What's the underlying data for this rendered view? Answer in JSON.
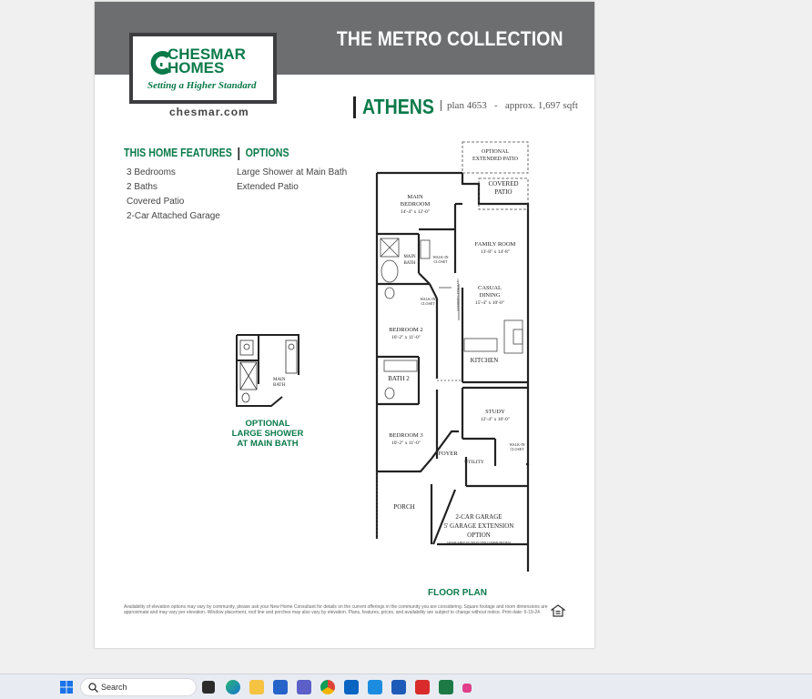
{
  "header": {
    "collection_title": "THE METRO COLLECTION"
  },
  "logo": {
    "line1": "CHESMAR",
    "line2": "HOMES",
    "tagline": "Setting a Higher Standard"
  },
  "website": "chesmar.com",
  "plan": {
    "name": "ATHENS",
    "plan_number": "plan 4653",
    "separator": "-",
    "size": "approx. 1,697 sqft"
  },
  "features": {
    "heading": "THIS HOME FEATURES",
    "options_heading": "OPTIONS",
    "items": [
      "3 Bedrooms",
      "2 Baths",
      "Covered Patio",
      "2-Car Attached Garage"
    ],
    "options": [
      "Large Shower at Main Bath",
      "Extended Patio"
    ]
  },
  "rooms": {
    "optional_patio": [
      "OPTIONAL",
      "EXTENDED PATIO"
    ],
    "covered_patio": [
      "COVERED",
      "PATIO"
    ],
    "main_bedroom": [
      "MAIN",
      "BEDROOM",
      "14'-4\" x 12'-0\""
    ],
    "family_room": [
      "FAMILY ROOM",
      "13'-8\" x 14'-8\""
    ],
    "main_bath": [
      "MAIN",
      "BATH"
    ],
    "walkin_closet_1": [
      "WALK-IN",
      "CLOSET"
    ],
    "walkin_closet_2": [
      "WALK-IN",
      "CLOSET"
    ],
    "optional_cabinets": "OPTIONAL CABINETS",
    "casual_dining": [
      "CASUAL",
      "DINING",
      "15'-4\" x 10'-0\""
    ],
    "bedroom_2": [
      "BEDROOM 2",
      "10'-2\" x 11'-0\""
    ],
    "kitchen": "KITCHEN",
    "bath_2": "BATH 2",
    "study": [
      "STUDY",
      "12'-4\" x 10'-0\""
    ],
    "bedroom_3": [
      "BEDROOM 3",
      "10'-2\" x 11'-0\""
    ],
    "foyer": "FOYER",
    "utility": "UTILITY",
    "walkin_closet_3": [
      "WALK-IN",
      "CLOSET"
    ],
    "porch": "PORCH",
    "garage": [
      "2-CAR GARAGE",
      "5' GARAGE EXTENSION",
      "OPTION",
      "(AVAILABLE IN SELECTED COMMUNITIES)"
    ]
  },
  "mini_plan": {
    "label": [
      "MAIN",
      "BATH"
    ],
    "caption": [
      "OPTIONAL",
      "LARGE SHOWER",
      "AT MAIN BATH"
    ]
  },
  "floorplan_label": "FLOOR PLAN",
  "disclaimer": "Availability of elevation options may vary by community, please ask your New Home Consultant for details on the current offerings in the community you are considering. Square footage and room dimensions are approximate and may vary per elevation. Window placement, roof line and porches may also vary by elevation. Plans, features, prices, and availability are subject to change without notice. Print date: 6-19-24",
  "taskbar": {
    "search_label": "Search",
    "icons": [
      "windows-icon",
      "task-view-icon",
      "edge-icon",
      "file-explorer-icon",
      "store-icon",
      "teams-icon",
      "chrome-icon",
      "outlook-icon",
      "outlook-new-icon",
      "word-icon",
      "acrobat-icon",
      "excel-icon",
      "snipping-tool-icon"
    ]
  },
  "colors": {
    "brand_green": "#0b7a4a",
    "header_gray": "#6d6e70"
  }
}
